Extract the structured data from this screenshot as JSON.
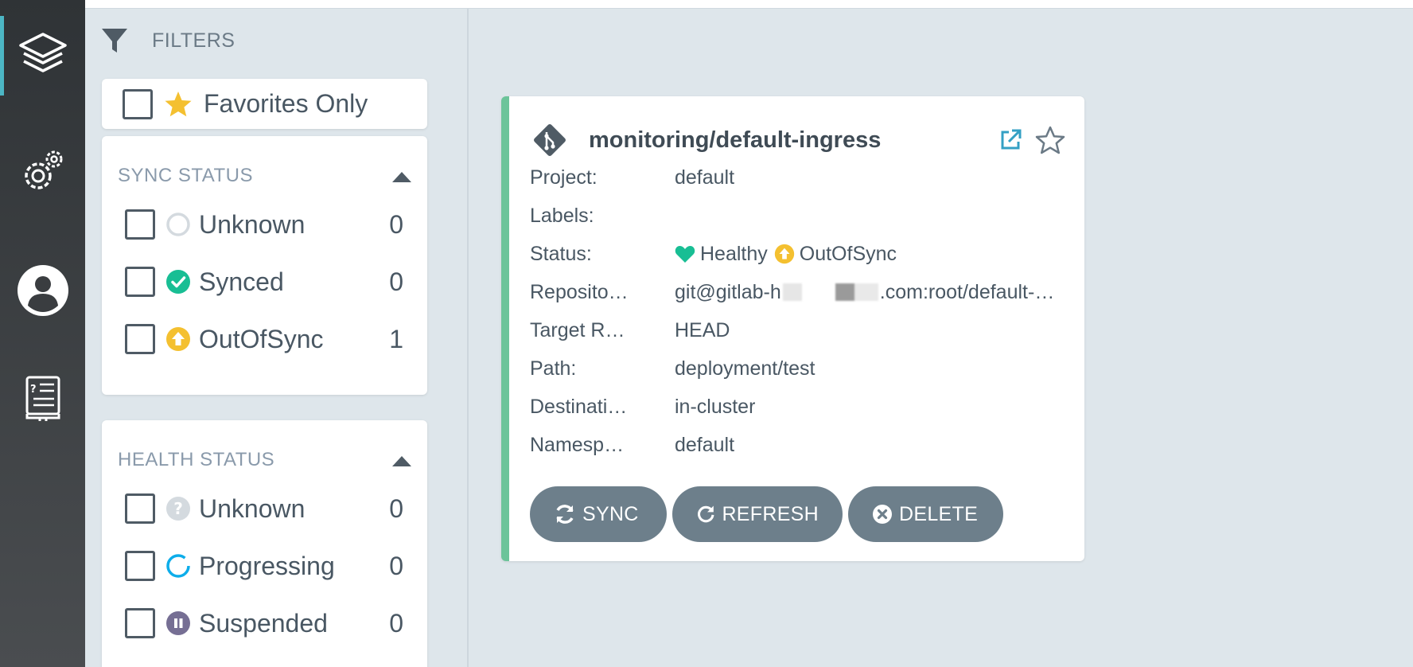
{
  "nav": {
    "items": [
      {
        "name": "applications",
        "icon": "layers-icon",
        "active": true
      },
      {
        "name": "settings",
        "icon": "gears-icon",
        "active": false
      },
      {
        "name": "user-info",
        "icon": "user-icon",
        "active": false
      },
      {
        "name": "documentation",
        "icon": "docs-icon",
        "active": false
      }
    ]
  },
  "filters": {
    "title": "FILTERS",
    "favorites_label": "Favorites Only",
    "sync_status": {
      "title": "SYNC STATUS",
      "items": [
        {
          "label": "Unknown",
          "count": "0",
          "icon": "circle-outline-icon"
        },
        {
          "label": "Synced",
          "count": "0",
          "icon": "check-circle-icon"
        },
        {
          "label": "OutOfSync",
          "count": "1",
          "icon": "arrow-up-circle-icon"
        }
      ]
    },
    "health_status": {
      "title": "HEALTH STATUS",
      "items": [
        {
          "label": "Unknown",
          "count": "0",
          "icon": "question-circle-icon"
        },
        {
          "label": "Progressing",
          "count": "0",
          "icon": "progress-ring-icon"
        },
        {
          "label": "Suspended",
          "count": "0",
          "icon": "pause-circle-icon"
        }
      ]
    }
  },
  "app": {
    "title": "monitoring/default-ingress",
    "fields": {
      "project_label": "Project:",
      "project_value": "default",
      "labels_label": "Labels:",
      "labels_value": "",
      "status_label": "Status:",
      "health": "Healthy",
      "sync": "OutOfSync",
      "repo_label": "Reposito…",
      "repo_prefix": "git@gitlab-h",
      "repo_suffix": ".com:root/default-…",
      "target_label": "Target R…",
      "target_value": "HEAD",
      "path_label": "Path:",
      "path_value": "deployment/test",
      "dest_label": "Destinati…",
      "dest_value": "in-cluster",
      "ns_label": "Namesp…",
      "ns_value": "default"
    },
    "buttons": {
      "sync": "SYNC",
      "refresh": "REFRESH",
      "delete": "DELETE"
    }
  },
  "colors": {
    "healthy": "#18be94",
    "out_of_sync": "#f4c030",
    "synced": "#18be94",
    "progressing": "#0dadea",
    "suspended": "#766f94",
    "card_accent": "#6cc49a",
    "button": "#6d7f8b"
  }
}
